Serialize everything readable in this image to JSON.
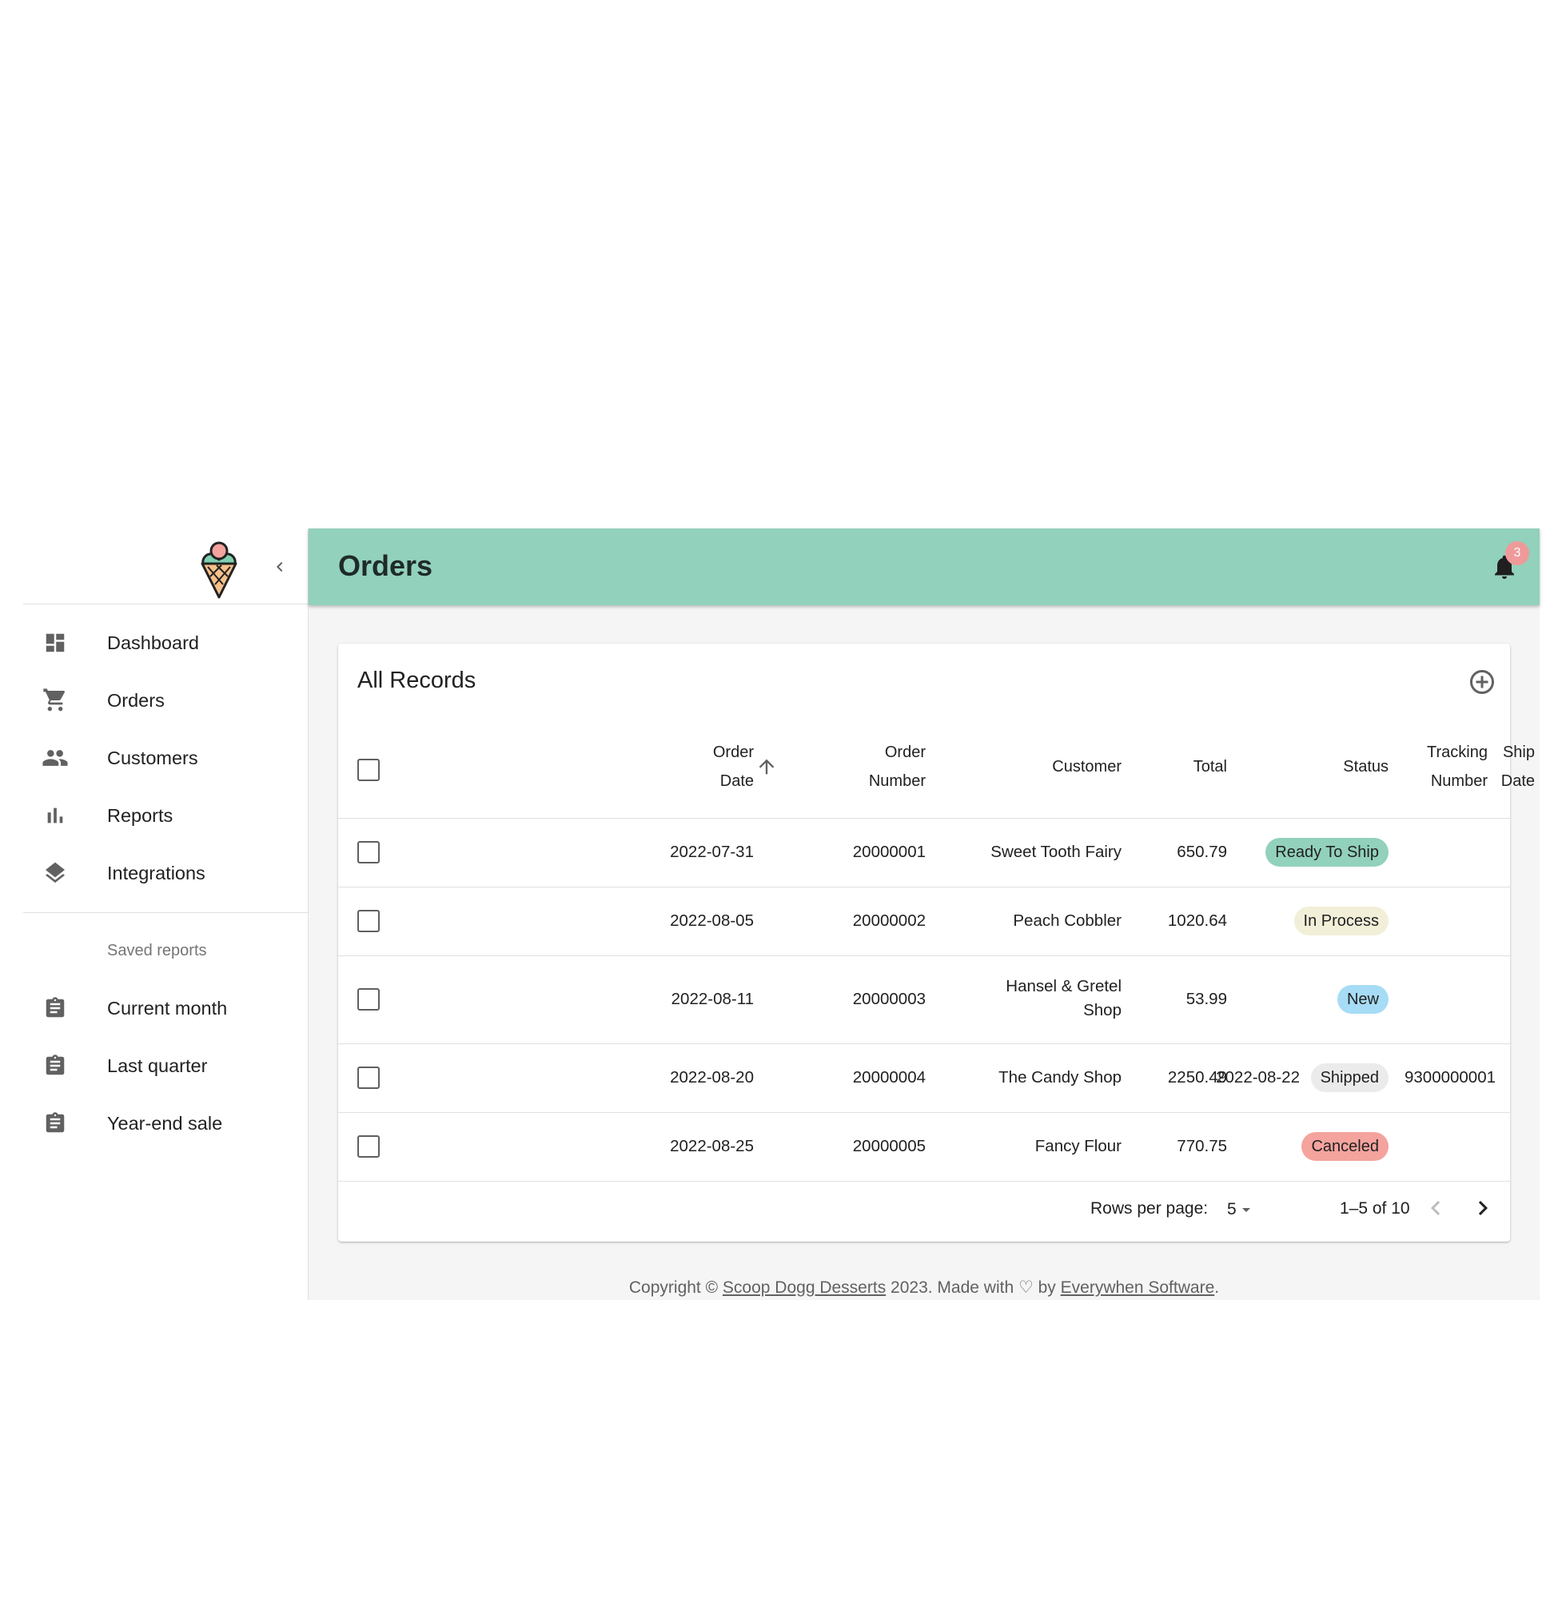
{
  "sidebar": {
    "collapse_icon": "chevron-left-icon",
    "nav": [
      {
        "label": "Dashboard",
        "icon": "dashboard-icon"
      },
      {
        "label": "Orders",
        "icon": "shopping-cart-icon"
      },
      {
        "label": "Customers",
        "icon": "people-icon"
      },
      {
        "label": "Reports",
        "icon": "bar-chart-icon"
      },
      {
        "label": "Integrations",
        "icon": "layers-icon"
      }
    ],
    "saved_reports_title": "Saved reports",
    "saved_reports": [
      {
        "label": "Current month",
        "icon": "assignment-icon"
      },
      {
        "label": "Last quarter",
        "icon": "assignment-icon"
      },
      {
        "label": "Year-end sale",
        "icon": "assignment-icon"
      }
    ]
  },
  "header": {
    "title": "Orders",
    "notifications_count": "3",
    "bar_color": "#92d1bb"
  },
  "card": {
    "title": "All Records",
    "columns": {
      "order_date_1": "Order",
      "order_date_2": "Date",
      "order_number_1": "Order",
      "order_number_2": "Number",
      "customer": "Customer",
      "total": "Total",
      "status": "Status",
      "ship_date_1": "Ship",
      "ship_date_2": "Date",
      "tracking_1": "Tracking",
      "tracking_2": "Number"
    },
    "sort": {
      "column": "Order Date",
      "direction": "ascending"
    },
    "rows": [
      {
        "date": "2022-07-31",
        "number": "20000001",
        "customer_1": "Sweet Tooth Fairy",
        "customer_2": "",
        "total": "650.79",
        "status": "Ready To Ship",
        "status_color": "#92d1bb",
        "ship_date": "",
        "tracking": ""
      },
      {
        "date": "2022-08-05",
        "number": "20000002",
        "customer_1": "Peach Cobbler",
        "customer_2": "",
        "total": "1020.64",
        "status": "In Process",
        "status_color": "#f2efd9",
        "ship_date": "",
        "tracking": ""
      },
      {
        "date": "2022-08-11",
        "number": "20000003",
        "customer_1": "Hansel & Gretel",
        "customer_2": "Shop",
        "total": "53.99",
        "status": "New",
        "status_color": "#a6dcf5",
        "ship_date": "",
        "tracking": ""
      },
      {
        "date": "2022-08-20",
        "number": "20000004",
        "customer_1": "The Candy Shop",
        "customer_2": "",
        "total": "2250.49",
        "status": "Shipped",
        "status_color": "#ebebeb",
        "ship_date": "2022-08-22",
        "tracking": "9300000001"
      },
      {
        "date": "2022-08-25",
        "number": "20000005",
        "customer_1": "Fancy Flour",
        "customer_2": "",
        "total": "770.75",
        "status": "Canceled",
        "status_color": "#f4a39d",
        "ship_date": "",
        "tracking": ""
      }
    ],
    "pagination": {
      "rows_per_page_label": "Rows per page:",
      "rows_per_page": "5",
      "range": "1–5 of 10"
    }
  },
  "footer": {
    "prefix": "Copyright © ",
    "company": "Scoop Dogg Desserts",
    "middle": " 2023. Made with ♡ by ",
    "vendor": "Everywhen Software",
    "suffix": "."
  }
}
